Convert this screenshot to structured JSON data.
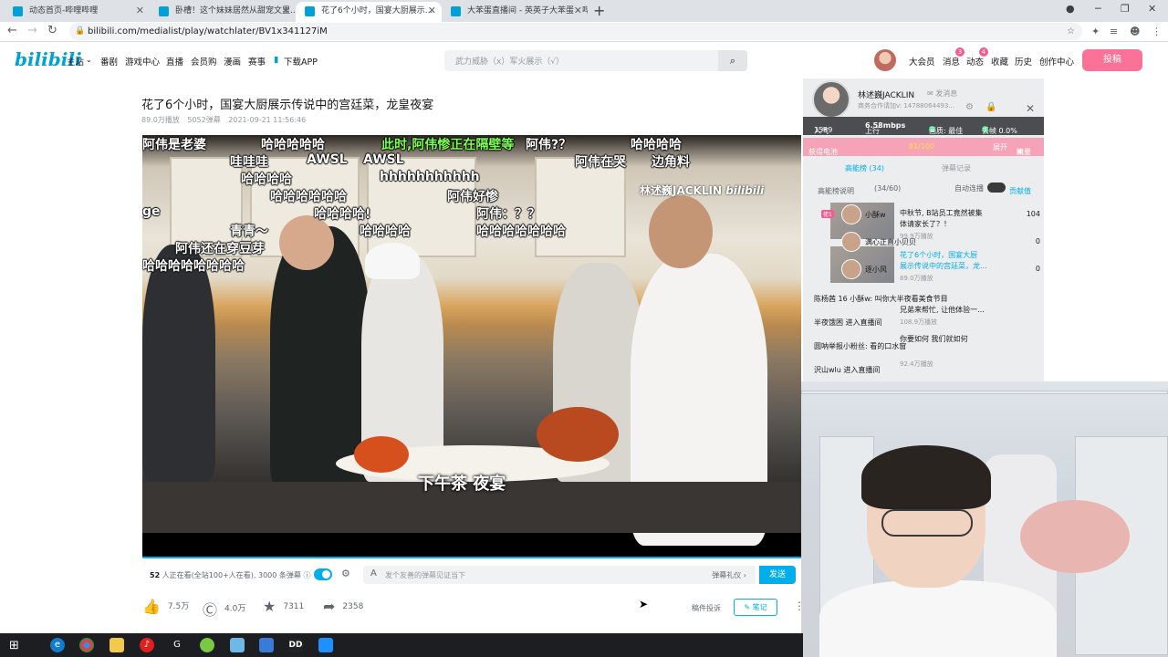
{
  "browser": {
    "tabs": [
      {
        "title": "动态首页-哔哩哔哩",
        "active": false
      },
      {
        "title": "卧槽！这个妹妹居然从甜宠文里...",
        "active": false
      },
      {
        "title": "花了6个小时，国宴大厨展示...",
        "active": true
      },
      {
        "title": "大苯蛋直播间 - 英英子大苯蛋 - 哔...",
        "active": false
      }
    ],
    "url": "bilibili.com/medialist/play/watchlater/BV1x341127iM"
  },
  "header": {
    "logo": "bilibili",
    "nav": [
      "主站",
      "番剧",
      "游戏中心",
      "直播",
      "会员购",
      "漫画",
      "赛事",
      "下载APP"
    ],
    "search_placeholder": "武力威胁（x）军火展示（√）",
    "right_links": [
      "大会员",
      "消息",
      "动态",
      "收藏",
      "历史",
      "创作中心"
    ],
    "badges": {
      "messages": "3",
      "dynamics": "4"
    },
    "upload_label": "投稿"
  },
  "video": {
    "title": "花了6个小时，国宴大厨展示传说中的宫廷菜，龙皇夜宴",
    "views": "89.0万播放",
    "danmaku_count": "5052弹幕",
    "date": "2021-09-21 11:56:46",
    "watermark": "林述巍JACKLIN",
    "subtitle": "下午茶 夜宴",
    "danmaku": [
      {
        "text": "阿伟是老婆",
        "color": "white"
      },
      {
        "text": "哈哈哈哈哈",
        "color": "white"
      },
      {
        "text": "此时,阿伟惨正在隔壁等",
        "color": "green"
      },
      {
        "text": "阿伟?？",
        "color": "white"
      },
      {
        "text": "哈哈哈哈",
        "color": "white"
      },
      {
        "text": "哇哇哇",
        "color": "white"
      },
      {
        "text": "AWSL",
        "color": "white"
      },
      {
        "text": "AWSL",
        "color": "white"
      },
      {
        "text": "阿伟在哭",
        "color": "white"
      },
      {
        "text": "边角料",
        "color": "white"
      },
      {
        "text": "哈哈哈哈",
        "color": "white"
      },
      {
        "text": "hhhhhhhhhhh",
        "color": "white"
      },
      {
        "text": "哈哈哈哈哈哈",
        "color": "white"
      },
      {
        "text": "阿伟好惨",
        "color": "white"
      },
      {
        "text": "哈哈哈哈!",
        "color": "white"
      },
      {
        "text": "阿伟：？？",
        "color": "white"
      },
      {
        "text": "青青～",
        "color": "white"
      },
      {
        "text": "哈哈哈哈",
        "color": "white"
      },
      {
        "text": "哈哈哈哈哈哈哈",
        "color": "white"
      },
      {
        "text": "阿伟还在穿豆芽",
        "color": "white"
      },
      {
        "text": "哈哈哈哈哈哈哈哈",
        "color": "white"
      },
      {
        "text": "ge",
        "color": "white"
      }
    ]
  },
  "send_bar": {
    "viewers_count": "52",
    "viewers_text": "人正在看(全站100+人在看), 3000 条弹幕",
    "input_placeholder": "发个友善的弹幕见证当下",
    "etiquette": "弹幕礼仪 ›",
    "send_label": "发送"
  },
  "actions": {
    "like": "7.5万",
    "coin": "4.0万",
    "favorite": "7311",
    "share": "2358",
    "report": "稿件投诉",
    "note": "笔记"
  },
  "overlay": {
    "up_name": "林述巍JACKLIN",
    "msg_link": "发消息",
    "up_desc": "商务合作请加v: 14788064493...",
    "stats": {
      "popularity_label": "人气",
      "popularity": "1589",
      "upload_label": "上行",
      "upload": "6.58mbps",
      "quality_label": "画质: 最佳",
      "drop_label": "丢帧 0.0%"
    },
    "battery": {
      "label": "获得电池",
      "progress": "81/100",
      "expand": "展开",
      "flow": "流量"
    },
    "tabs": [
      "高能榜 (34)",
      "弹幕记录"
    ],
    "rank_header": "高能榜说明",
    "rank_count": "(34/60)",
    "auto_refresh": "自动连播",
    "contrib": "贡献值",
    "ranks": [
      {
        "tag": "佬1",
        "name": "小酥w",
        "score": "104"
      },
      {
        "tag": "",
        "name": "满心正直小贝贝",
        "score": "0"
      },
      {
        "tag": "",
        "name": "逐小风",
        "score": "0"
      }
    ],
    "recs": [
      {
        "text": "中秋节, B站员工竟然被集",
        "cls": ""
      },
      {
        "text": "体请家长了？！",
        "cls": ""
      },
      {
        "text": "99.9万播放",
        "cls": "sub"
      },
      {
        "text": "花了6个小时，国宴大厨",
        "cls": "blue"
      },
      {
        "text": "展示传说中的宫廷菜，龙...",
        "cls": "blue"
      },
      {
        "text": "89.0万播放",
        "cls": "sub"
      }
    ],
    "chats": [
      {
        "text": "陈杨茜 16 小酥w: 叫你大半夜看美食节目"
      },
      {
        "text": "兄弟来帮忙, 让他体验一..."
      },
      {
        "text": "半夜饿困 进入直播间"
      },
      {
        "text": "108.9万播放"
      },
      {
        "text": "圆呐举报小粉丝: 看的口水窗"
      },
      {
        "text": "你要如何 我们就如何"
      },
      {
        "text": "92.4万播放"
      },
      {
        "text": "沢山wlu 进入直播间"
      }
    ]
  },
  "colors": {
    "accent": "#00aeec",
    "pink": "#fb7299",
    "brand": "#00a1d6"
  },
  "taskbar": [
    "windows-start",
    "edge",
    "chrome",
    "file-explorer",
    "netease-music",
    "g-app",
    "green-app",
    "app-7",
    "app-8",
    "dd-app",
    "app-10"
  ]
}
